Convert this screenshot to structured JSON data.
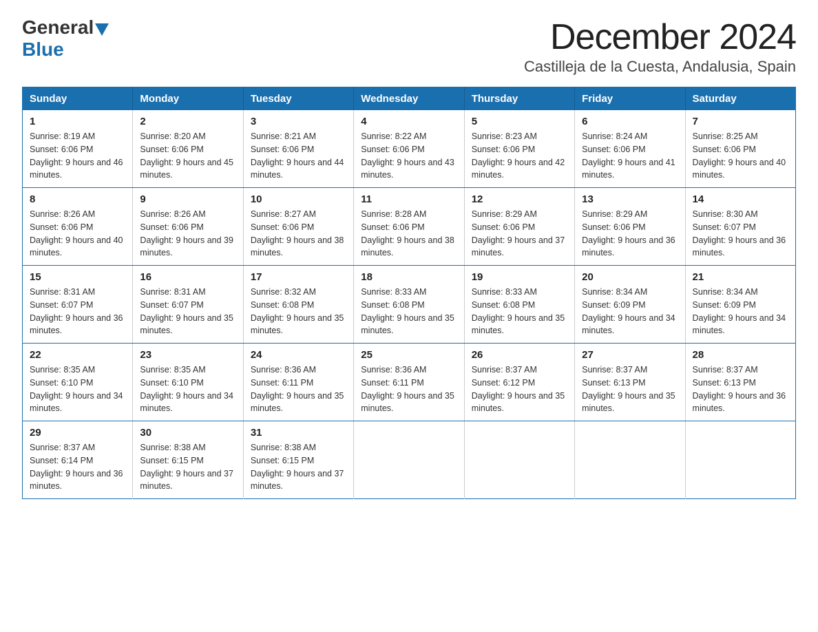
{
  "logo": {
    "general": "General",
    "blue": "Blue"
  },
  "title": "December 2024",
  "subtitle": "Castilleja de la Cuesta, Andalusia, Spain",
  "headers": [
    "Sunday",
    "Monday",
    "Tuesday",
    "Wednesday",
    "Thursday",
    "Friday",
    "Saturday"
  ],
  "weeks": [
    [
      {
        "num": "1",
        "sunrise": "8:19 AM",
        "sunset": "6:06 PM",
        "daylight": "9 hours and 46 minutes."
      },
      {
        "num": "2",
        "sunrise": "8:20 AM",
        "sunset": "6:06 PM",
        "daylight": "9 hours and 45 minutes."
      },
      {
        "num": "3",
        "sunrise": "8:21 AM",
        "sunset": "6:06 PM",
        "daylight": "9 hours and 44 minutes."
      },
      {
        "num": "4",
        "sunrise": "8:22 AM",
        "sunset": "6:06 PM",
        "daylight": "9 hours and 43 minutes."
      },
      {
        "num": "5",
        "sunrise": "8:23 AM",
        "sunset": "6:06 PM",
        "daylight": "9 hours and 42 minutes."
      },
      {
        "num": "6",
        "sunrise": "8:24 AM",
        "sunset": "6:06 PM",
        "daylight": "9 hours and 41 minutes."
      },
      {
        "num": "7",
        "sunrise": "8:25 AM",
        "sunset": "6:06 PM",
        "daylight": "9 hours and 40 minutes."
      }
    ],
    [
      {
        "num": "8",
        "sunrise": "8:26 AM",
        "sunset": "6:06 PM",
        "daylight": "9 hours and 40 minutes."
      },
      {
        "num": "9",
        "sunrise": "8:26 AM",
        "sunset": "6:06 PM",
        "daylight": "9 hours and 39 minutes."
      },
      {
        "num": "10",
        "sunrise": "8:27 AM",
        "sunset": "6:06 PM",
        "daylight": "9 hours and 38 minutes."
      },
      {
        "num": "11",
        "sunrise": "8:28 AM",
        "sunset": "6:06 PM",
        "daylight": "9 hours and 38 minutes."
      },
      {
        "num": "12",
        "sunrise": "8:29 AM",
        "sunset": "6:06 PM",
        "daylight": "9 hours and 37 minutes."
      },
      {
        "num": "13",
        "sunrise": "8:29 AM",
        "sunset": "6:06 PM",
        "daylight": "9 hours and 36 minutes."
      },
      {
        "num": "14",
        "sunrise": "8:30 AM",
        "sunset": "6:07 PM",
        "daylight": "9 hours and 36 minutes."
      }
    ],
    [
      {
        "num": "15",
        "sunrise": "8:31 AM",
        "sunset": "6:07 PM",
        "daylight": "9 hours and 36 minutes."
      },
      {
        "num": "16",
        "sunrise": "8:31 AM",
        "sunset": "6:07 PM",
        "daylight": "9 hours and 35 minutes."
      },
      {
        "num": "17",
        "sunrise": "8:32 AM",
        "sunset": "6:08 PM",
        "daylight": "9 hours and 35 minutes."
      },
      {
        "num": "18",
        "sunrise": "8:33 AM",
        "sunset": "6:08 PM",
        "daylight": "9 hours and 35 minutes."
      },
      {
        "num": "19",
        "sunrise": "8:33 AM",
        "sunset": "6:08 PM",
        "daylight": "9 hours and 35 minutes."
      },
      {
        "num": "20",
        "sunrise": "8:34 AM",
        "sunset": "6:09 PM",
        "daylight": "9 hours and 34 minutes."
      },
      {
        "num": "21",
        "sunrise": "8:34 AM",
        "sunset": "6:09 PM",
        "daylight": "9 hours and 34 minutes."
      }
    ],
    [
      {
        "num": "22",
        "sunrise": "8:35 AM",
        "sunset": "6:10 PM",
        "daylight": "9 hours and 34 minutes."
      },
      {
        "num": "23",
        "sunrise": "8:35 AM",
        "sunset": "6:10 PM",
        "daylight": "9 hours and 34 minutes."
      },
      {
        "num": "24",
        "sunrise": "8:36 AM",
        "sunset": "6:11 PM",
        "daylight": "9 hours and 35 minutes."
      },
      {
        "num": "25",
        "sunrise": "8:36 AM",
        "sunset": "6:11 PM",
        "daylight": "9 hours and 35 minutes."
      },
      {
        "num": "26",
        "sunrise": "8:37 AM",
        "sunset": "6:12 PM",
        "daylight": "9 hours and 35 minutes."
      },
      {
        "num": "27",
        "sunrise": "8:37 AM",
        "sunset": "6:13 PM",
        "daylight": "9 hours and 35 minutes."
      },
      {
        "num": "28",
        "sunrise": "8:37 AM",
        "sunset": "6:13 PM",
        "daylight": "9 hours and 36 minutes."
      }
    ],
    [
      {
        "num": "29",
        "sunrise": "8:37 AM",
        "sunset": "6:14 PM",
        "daylight": "9 hours and 36 minutes."
      },
      {
        "num": "30",
        "sunrise": "8:38 AM",
        "sunset": "6:15 PM",
        "daylight": "9 hours and 37 minutes."
      },
      {
        "num": "31",
        "sunrise": "8:38 AM",
        "sunset": "6:15 PM",
        "daylight": "9 hours and 37 minutes."
      },
      null,
      null,
      null,
      null
    ]
  ]
}
